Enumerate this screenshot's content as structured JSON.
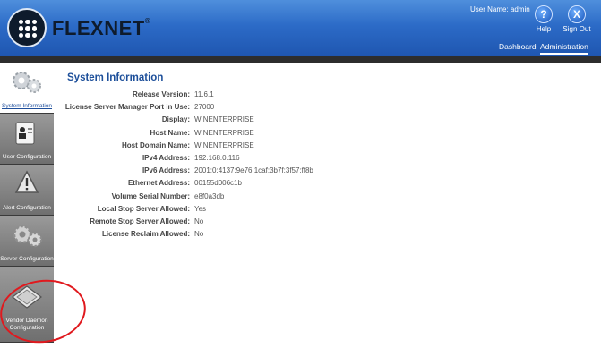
{
  "header": {
    "brand": "FLEXNET",
    "brand_mark": "®",
    "username": "User Name: admin",
    "help_label": "Help",
    "signout_label": "Sign Out",
    "help_icon_glyph": "?",
    "signout_icon_glyph": "X"
  },
  "nav": {
    "dashboard": "Dashboard",
    "administration": "Administration"
  },
  "sidebar": {
    "items": [
      {
        "label": "System Information",
        "icon": "gear-cluster-icon",
        "active": true
      },
      {
        "label": "User Configuration",
        "icon": "user-badge-icon"
      },
      {
        "label": "Alert Configuration",
        "icon": "warning-icon"
      },
      {
        "label": "Server Configuration",
        "icon": "gears-icon"
      },
      {
        "label": "Vendor Daemon Configuration",
        "icon": "license-card-icon"
      }
    ]
  },
  "main": {
    "title": "System Information",
    "rows": [
      {
        "label": "Release Version:",
        "value": "11.6.1"
      },
      {
        "label": "License Server Manager Port in Use:",
        "value": "27000"
      },
      {
        "label": "Display:",
        "value": "WINENTERPRISE"
      },
      {
        "label": "Host Name:",
        "value": "WINENTERPRISE"
      },
      {
        "label": "Host Domain Name:",
        "value": "WINENTERPRISE"
      },
      {
        "label": "IPv4 Address:",
        "value": "192.168.0.116"
      },
      {
        "label": "IPv6 Address:",
        "value": "2001:0:4137:9e76:1caf:3b7f:3f57:ff8b"
      },
      {
        "label": "Ethernet Address:",
        "value": "00155d006c1b"
      },
      {
        "label": "Volume Serial Number:",
        "value": "e8f0a3db"
      },
      {
        "label": "Local Stop Server Allowed:",
        "value": "Yes"
      },
      {
        "label": "Remote Stop Server Allowed:",
        "value": "No"
      },
      {
        "label": "License Reclaim Allowed:",
        "value": "No"
      }
    ]
  },
  "colors": {
    "header_blue": "#2c6bc7",
    "title_blue": "#1d4f9a",
    "annotation_red": "#e0191e"
  }
}
